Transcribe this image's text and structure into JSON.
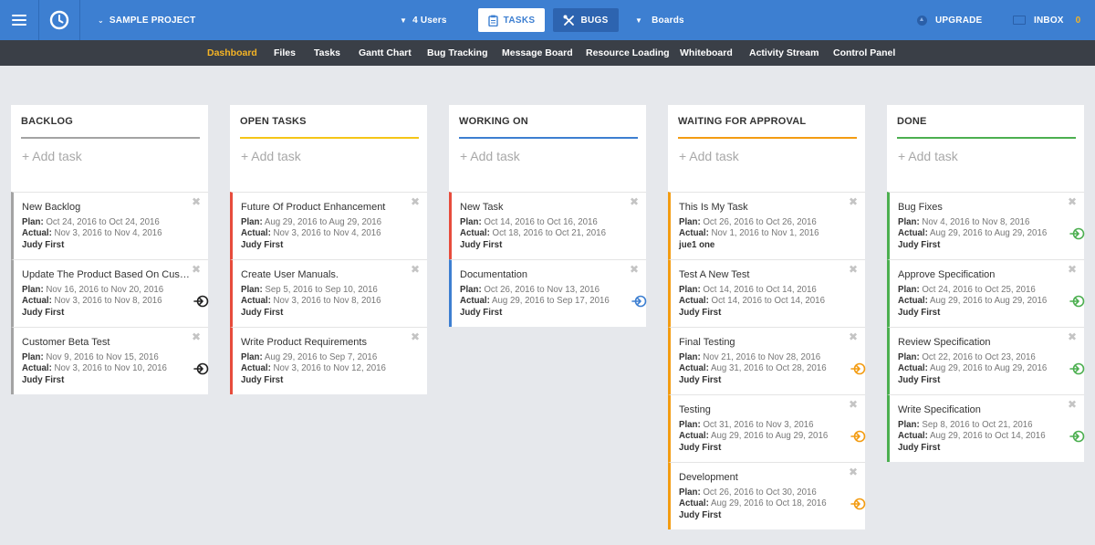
{
  "topbar": {
    "project_name": "SAMPLE PROJECT",
    "users_label": "4 Users",
    "tasks_button": "TASKS",
    "bugs_button": "BUGS",
    "boards_label": "Boards",
    "upgrade_label": "UPGRADE",
    "inbox_label": "INBOX",
    "inbox_count": "0"
  },
  "nav": {
    "items": [
      "Dashboard",
      "Files",
      "Tasks",
      "Gantt Chart",
      "Bug Tracking",
      "Message Board",
      "Resource Loading",
      "Whiteboard",
      "Activity Stream",
      "Control Panel"
    ],
    "active": "Dashboard"
  },
  "colors": {
    "topbar": "#3d7fd1",
    "navbar": "#3a3f47",
    "nav_active": "#f5b425",
    "backlog": "#a3a3a3",
    "open_tasks": "#f5c518",
    "working_on": "#3d7fd1",
    "waiting": "#f39c12",
    "done": "#4caf50",
    "red": "#e74c3c"
  },
  "plan_label": "Plan:",
  "actual_label": "Actual:",
  "to_word": "to",
  "columns": [
    {
      "title": "BACKLOG",
      "add_task": "+ Add task",
      "accent": "#a3a3a3",
      "cards": [
        {
          "title": "New Backlog",
          "plan": "Oct 24, 2016 to Oct 24, 2016",
          "actual": "Nov 3, 2016 to Nov 4, 2016",
          "owner": "Judy First",
          "border": "#a3a3a3",
          "icon": ""
        },
        {
          "title": "Update The Product Based On Customer Feedback",
          "plan": "Nov 16, 2016 to Nov 20, 2016",
          "actual": "Nov 3, 2016 to Nov 8, 2016",
          "owner": "Judy First",
          "border": "#a3a3a3",
          "icon": "#222222"
        },
        {
          "title": "Customer Beta Test",
          "plan": "Nov 9, 2016 to Nov 15, 2016",
          "actual": "Nov 3, 2016 to Nov 10, 2016",
          "owner": "Judy First",
          "border": "#a3a3a3",
          "icon": "#222222"
        }
      ]
    },
    {
      "title": "OPEN TASKS",
      "add_task": "+ Add task",
      "accent": "#f5c518",
      "cards": [
        {
          "title": "Future Of Product Enhancement",
          "plan": "Aug 29, 2016 to Aug 29, 2016",
          "actual": "Nov 3, 2016 to Nov 4, 2016",
          "owner": "Judy First",
          "border": "#e74c3c",
          "icon": ""
        },
        {
          "title": "Create User Manuals.",
          "plan": "Sep 5, 2016 to Sep 10, 2016",
          "actual": "Nov 3, 2016 to Nov 8, 2016",
          "owner": "Judy First",
          "border": "#e74c3c",
          "icon": ""
        },
        {
          "title": "Write Product Requirements",
          "plan": "Aug 29, 2016 to Sep 7, 2016",
          "actual": "Nov 3, 2016 to Nov 12, 2016",
          "owner": "Judy First",
          "border": "#e74c3c",
          "icon": ""
        }
      ]
    },
    {
      "title": "WORKING ON",
      "add_task": "+ Add task",
      "accent": "#3d7fd1",
      "cards": [
        {
          "title": "New Task",
          "plan": "Oct 14, 2016 to Oct 16, 2016",
          "actual": "Oct 18, 2016 to Oct 21, 2016",
          "owner": "Judy First",
          "border": "#e74c3c",
          "icon": ""
        },
        {
          "title": "Documentation",
          "plan": "Oct 26, 2016 to Nov 13, 2016",
          "actual": "Aug 29, 2016 to Sep 17, 2016",
          "owner": "Judy First",
          "border": "#3d7fd1",
          "icon": "#3d7fd1"
        }
      ]
    },
    {
      "title": "WAITING FOR APPROVAL",
      "add_task": "+ Add task",
      "accent": "#f39c12",
      "cards": [
        {
          "title": "This Is My Task",
          "plan": "Oct 26, 2016 to Oct 26, 2016",
          "actual": "Nov 1, 2016 to Nov 1, 2016",
          "owner": "jue1 one",
          "border": "#f39c12",
          "icon": ""
        },
        {
          "title": "Test A New Test",
          "plan": "Oct 14, 2016 to Oct 14, 2016",
          "actual": "Oct 14, 2016 to Oct 14, 2016",
          "owner": "Judy First",
          "border": "#f39c12",
          "icon": ""
        },
        {
          "title": "Final Testing",
          "plan": "Nov 21, 2016 to Nov 28, 2016",
          "actual": "Aug 31, 2016 to Oct 28, 2016",
          "owner": "Judy First",
          "border": "#f39c12",
          "icon": "#f39c12"
        },
        {
          "title": "Testing",
          "plan": "Oct 31, 2016 to Nov 3, 2016",
          "actual": "Aug 29, 2016 to Aug 29, 2016",
          "owner": "Judy First",
          "border": "#f39c12",
          "icon": "#f39c12"
        },
        {
          "title": "Development",
          "plan": "Oct 26, 2016 to Oct 30, 2016",
          "actual": "Aug 29, 2016 to Oct 18, 2016",
          "owner": "Judy First",
          "border": "#f39c12",
          "icon": "#f39c12"
        }
      ]
    },
    {
      "title": "DONE",
      "add_task": "+ Add task",
      "accent": "#4caf50",
      "cards": [
        {
          "title": "Bug Fixes",
          "plan": "Nov 4, 2016 to Nov 8, 2016",
          "actual": "Aug 29, 2016 to Aug 29, 2016",
          "owner": "Judy First",
          "border": "#4caf50",
          "icon": "#4caf50"
        },
        {
          "title": "Approve Specification",
          "plan": "Oct 24, 2016 to Oct 25, 2016",
          "actual": "Aug 29, 2016 to Aug 29, 2016",
          "owner": "Judy First",
          "border": "#4caf50",
          "icon": "#4caf50"
        },
        {
          "title": "Review Specification",
          "plan": "Oct 22, 2016 to Oct 23, 2016",
          "actual": "Aug 29, 2016 to Aug 29, 2016",
          "owner": "Judy First",
          "border": "#4caf50",
          "icon": "#4caf50"
        },
        {
          "title": "Write Specification",
          "plan": "Sep 8, 2016 to Oct 21, 2016",
          "actual": "Aug 29, 2016 to Oct 14, 2016",
          "owner": "Judy First",
          "border": "#4caf50",
          "icon": "#4caf50"
        }
      ]
    }
  ]
}
